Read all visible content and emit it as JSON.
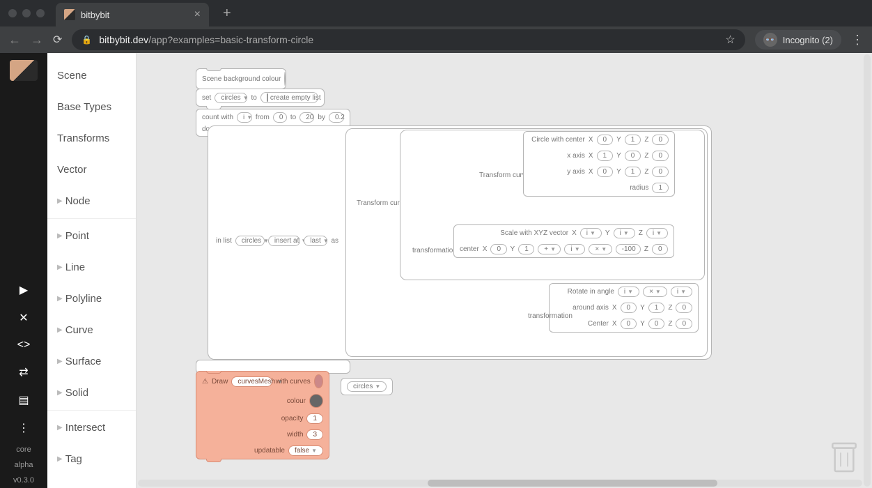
{
  "browser": {
    "tab_title": "bitbybit",
    "url_domain": "bitbybit.dev",
    "url_path": "/app?examples=basic-transform-circle",
    "incognito_label": "Incognito (2)"
  },
  "rail": {
    "core": "core",
    "alpha": "alpha",
    "version": "v0.3.0"
  },
  "toolbox": {
    "items": [
      {
        "label": "Scene",
        "expandable": false
      },
      {
        "label": "Base Types",
        "expandable": false
      },
      {
        "label": "Transforms",
        "expandable": false
      },
      {
        "label": "Vector",
        "expandable": false
      },
      {
        "label": "Node",
        "expandable": true
      },
      {
        "label": "Point",
        "expandable": true
      },
      {
        "label": "Line",
        "expandable": true
      },
      {
        "label": "Polyline",
        "expandable": true
      },
      {
        "label": "Curve",
        "expandable": true
      },
      {
        "label": "Surface",
        "expandable": true
      },
      {
        "label": "Solid",
        "expandable": true
      },
      {
        "label": "Intersect",
        "expandable": true
      },
      {
        "label": "Tag",
        "expandable": true
      }
    ]
  },
  "blocks": {
    "scene_bg": {
      "label": "Scene background colour"
    },
    "set": {
      "set": "set",
      "var": "circles",
      "to": "to",
      "create": "create empty list"
    },
    "count": {
      "label": "count with",
      "var": "i",
      "from": "from",
      "from_v": "0",
      "to": "to",
      "to_v": "20",
      "by": "by",
      "by_v": "0.2",
      "do": "do"
    },
    "inlist": {
      "label": "in list",
      "var": "circles",
      "action": "insert at",
      "pos": "last",
      "as": "as"
    },
    "transform1": {
      "label": "Transform curve"
    },
    "transform2": {
      "label": "Transform curve",
      "transformation": "transformation",
      "center": "center"
    },
    "circle": {
      "label": "Circle with center",
      "xaxis": "x axis",
      "yaxis": "y axis",
      "radius": "radius",
      "center_x": "0",
      "center_y": "1",
      "center_z": "0",
      "xax_x": "1",
      "xax_y": "0",
      "xax_z": "0",
      "yax_x": "0",
      "yax_y": "1",
      "yax_z": "0",
      "radius_v": "1"
    },
    "scale": {
      "label": "Scale with XYZ vector",
      "transformation": "transformation",
      "center": "center",
      "vx": "i",
      "vy": "i",
      "vz": "i",
      "cx": "0",
      "cy": "1",
      "op1": "+",
      "cvar": "i",
      "op2": "×",
      "cval": "-100",
      "cz": "0"
    },
    "rotate": {
      "label": "Rotate in angle",
      "transformation": "transformation",
      "around": "around axis",
      "center": "Center",
      "ang_var": "i",
      "ang_op": "×",
      "ang_var2": "i",
      "ax_x": "0",
      "ax_y": "1",
      "ax_z": "0",
      "c_x": "0",
      "c_y": "0",
      "c_z": "0"
    },
    "draw": {
      "label": "Draw",
      "mesh": "curvesMesh",
      "with": "with curves",
      "colour": "colour",
      "opacity": "opacity",
      "opacity_v": "1",
      "width": "width",
      "width_v": "3",
      "updatable": "updatable",
      "updatable_v": "false"
    },
    "circles_pill": "circles",
    "X": "X",
    "Y": "Y",
    "Z": "Z"
  }
}
